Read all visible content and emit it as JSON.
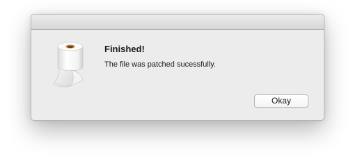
{
  "dialog": {
    "icon": "toilet-paper-roll-icon",
    "title": "Finished!",
    "message": "The file was patched sucessfully.",
    "button_label": "Okay"
  }
}
